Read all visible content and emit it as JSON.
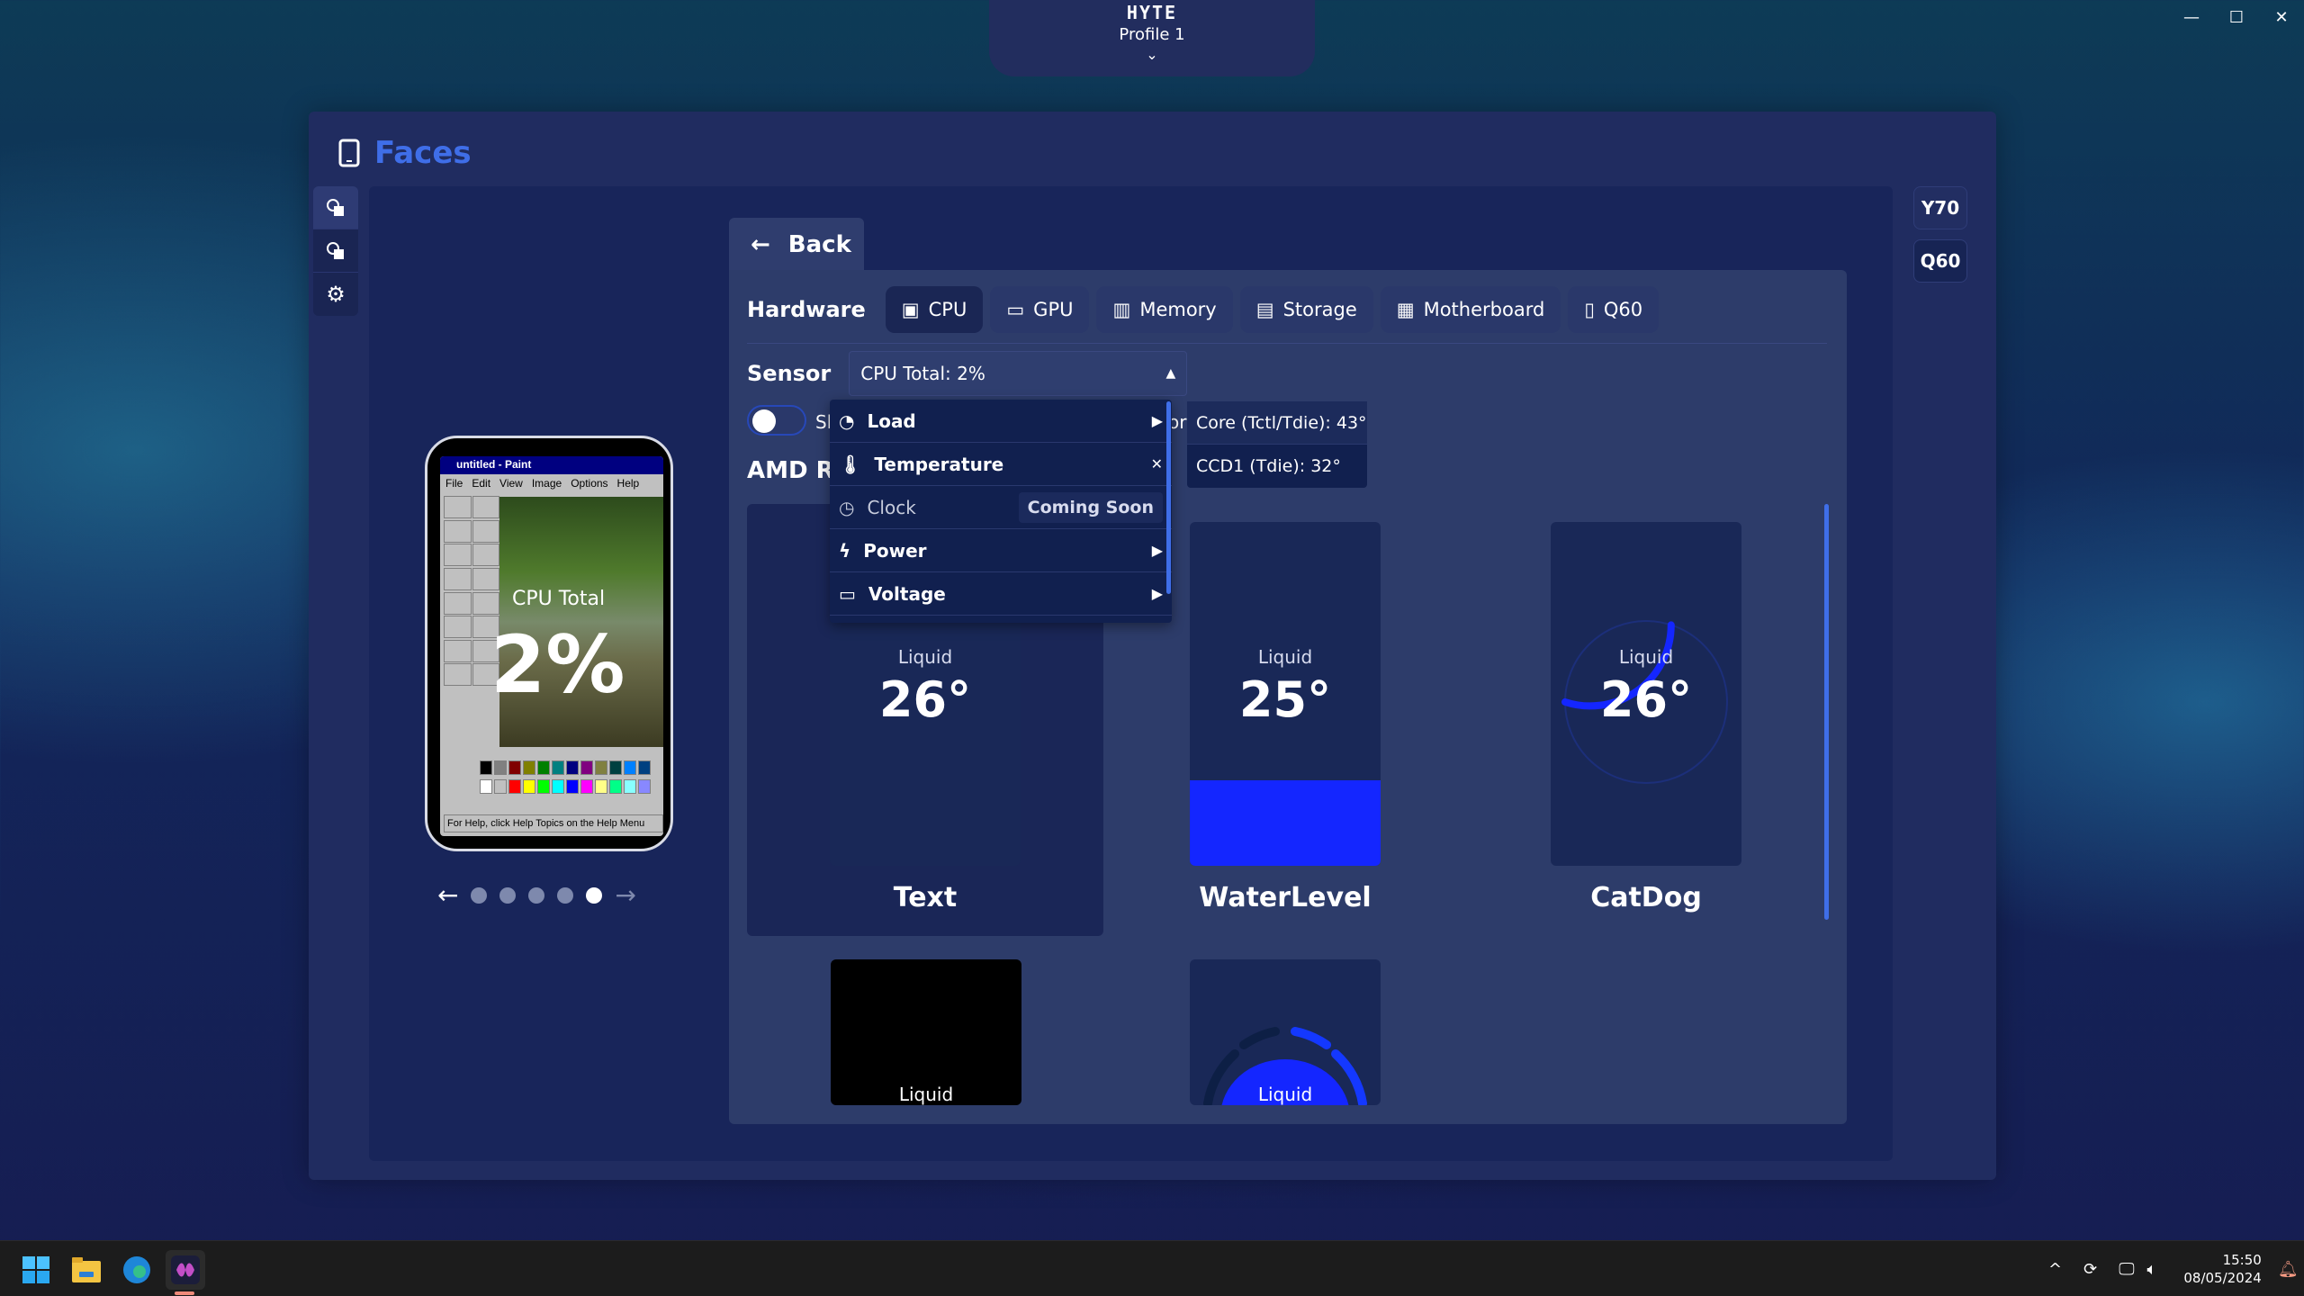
{
  "window_controls": {
    "minimize": "—",
    "maximize": "☐",
    "close": "✕"
  },
  "profile": {
    "brand": "HYTE",
    "name": "Profile 1",
    "chevron": "⌄"
  },
  "page": {
    "title": "Faces"
  },
  "devices": [
    {
      "label": "Y70"
    },
    {
      "label": "Q60"
    }
  ],
  "preview": {
    "paint_title": "untitled - Paint",
    "paint_menu": [
      "File",
      "Edit",
      "View",
      "Image",
      "Options",
      "Help"
    ],
    "paint_status": "For Help, click Help Topics on the Help Menu",
    "overlay_label": "CPU Total",
    "overlay_value": "2%",
    "pager": {
      "prev": "←",
      "next": "→",
      "pages": 5,
      "current": 5
    }
  },
  "back": {
    "label": "Back"
  },
  "hardware": {
    "label": "Hardware",
    "tabs": [
      {
        "label": "CPU",
        "active": true
      },
      {
        "label": "GPU"
      },
      {
        "label": "Memory"
      },
      {
        "label": "Storage"
      },
      {
        "label": "Motherboard"
      },
      {
        "label": "Q60"
      }
    ]
  },
  "sensor": {
    "label": "Sensor",
    "selected": "CPU Total: 2%",
    "arrow": "▲"
  },
  "toggle": {
    "label_partial": "Sh",
    "on": false
  },
  "device_name_partial": "AMD Ry",
  "or_partial": "or",
  "dropdown": {
    "items": [
      {
        "label": "Load",
        "end": "▶"
      },
      {
        "label": "Temperature",
        "end": "✕"
      },
      {
        "label": "Clock",
        "badge": "Coming Soon"
      },
      {
        "label": "Power",
        "end": "▶"
      },
      {
        "label": "Voltage",
        "end": "▶"
      }
    ],
    "submenu": [
      "Core (Tctl/Tdie): 43°",
      "CCD1 (Tdie): 32°"
    ]
  },
  "faces": [
    {
      "name": "Text",
      "label": "Liquid",
      "value": "26°"
    },
    {
      "name": "WaterLevel",
      "label": "Liquid",
      "value": "25°",
      "level": 0.25
    },
    {
      "name": "CatDog",
      "label": "Liquid",
      "value": "26°",
      "arc": 0.3
    },
    {
      "name": "",
      "label": "Liquid"
    },
    {
      "name": "",
      "label": "Liquid"
    }
  ],
  "taskbar": {
    "apps": [
      "windows-start",
      "file-explorer",
      "edge",
      "nexus"
    ],
    "time": "15:50",
    "date": "08/05/2024"
  },
  "colors": {
    "accent": "#3f6ee8",
    "fill": "#1426ff",
    "bg_panel": "#18255a"
  }
}
